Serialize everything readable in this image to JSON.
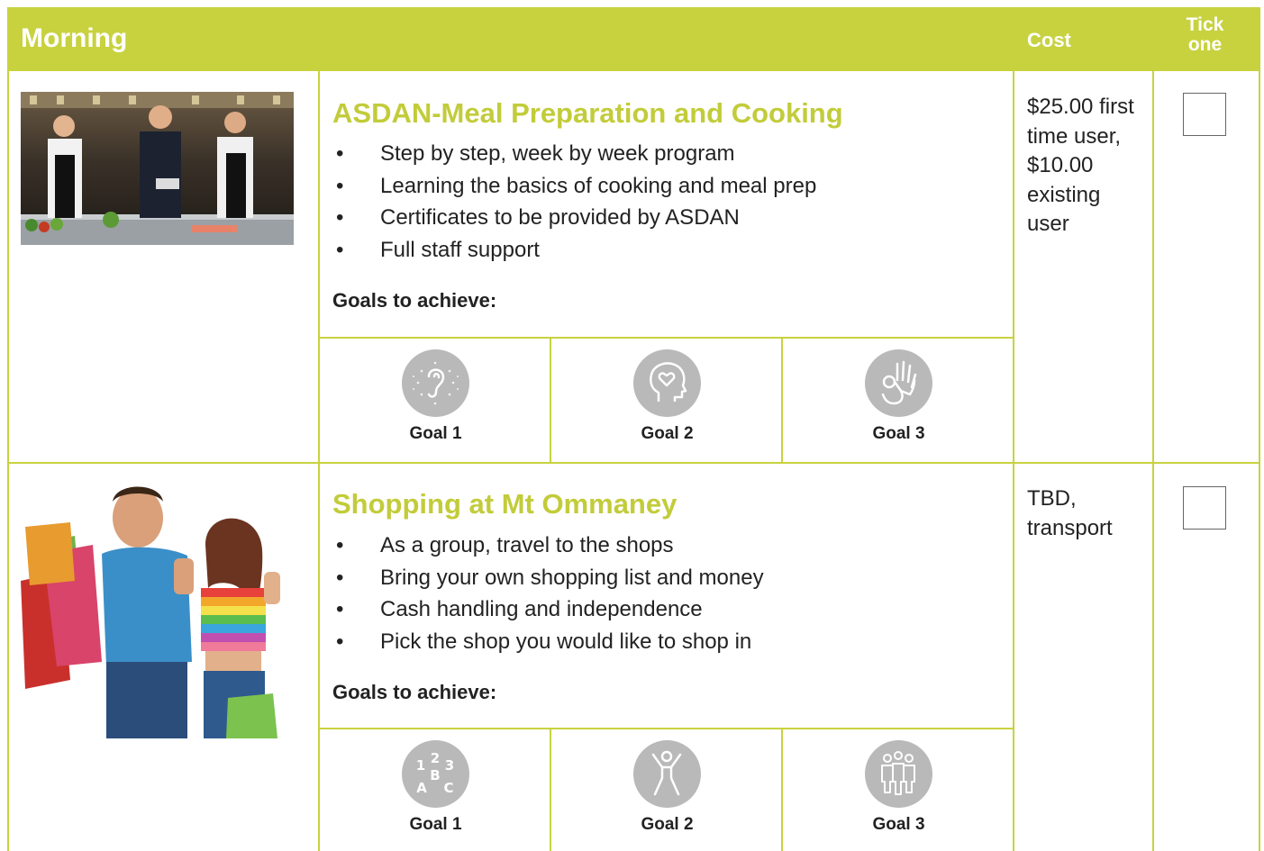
{
  "header": {
    "title": "Morning",
    "cost_label": "Cost",
    "tick_label_line1": "Tick",
    "tick_label_line2": "one"
  },
  "activities": [
    {
      "title": "ASDAN-Meal Preparation and Cooking",
      "bullets": [
        "Step by step, week by week program",
        "Learning the basics of cooking and meal prep",
        "Certificates to be provided by ASDAN",
        "Full staff support"
      ],
      "goals_label": "Goals to achieve:",
      "goals": [
        {
          "label": "Goal 1",
          "icon": "ear-listening-icon"
        },
        {
          "label": "Goal 2",
          "icon": "head-heart-icon"
        },
        {
          "label": "Goal 3",
          "icon": "ok-hand-icon"
        }
      ],
      "cost": "$25.00 first time user, $10.00 existing user",
      "photo": "chefs-cooking-photo",
      "ticked": false
    },
    {
      "title": "Shopping at Mt Ommaney",
      "bullets": [
        "As a group, travel to the shops",
        "Bring your own shopping list and money",
        "Cash handling and independence",
        "Pick the shop you would like to shop in"
      ],
      "goals_label": "Goals to achieve:",
      "goals": [
        {
          "label": "Goal 1",
          "icon": "numbers-letters-icon"
        },
        {
          "label": "Goal 2",
          "icon": "person-jumping-icon"
        },
        {
          "label": "Goal 3",
          "icon": "group-people-icon"
        }
      ],
      "cost": "TBD, transport",
      "photo": "shoppers-thumbs-up-photo",
      "ticked": false
    }
  ],
  "colors": {
    "accent": "#c8d23f",
    "icon_circle": "#b9b9b9"
  }
}
